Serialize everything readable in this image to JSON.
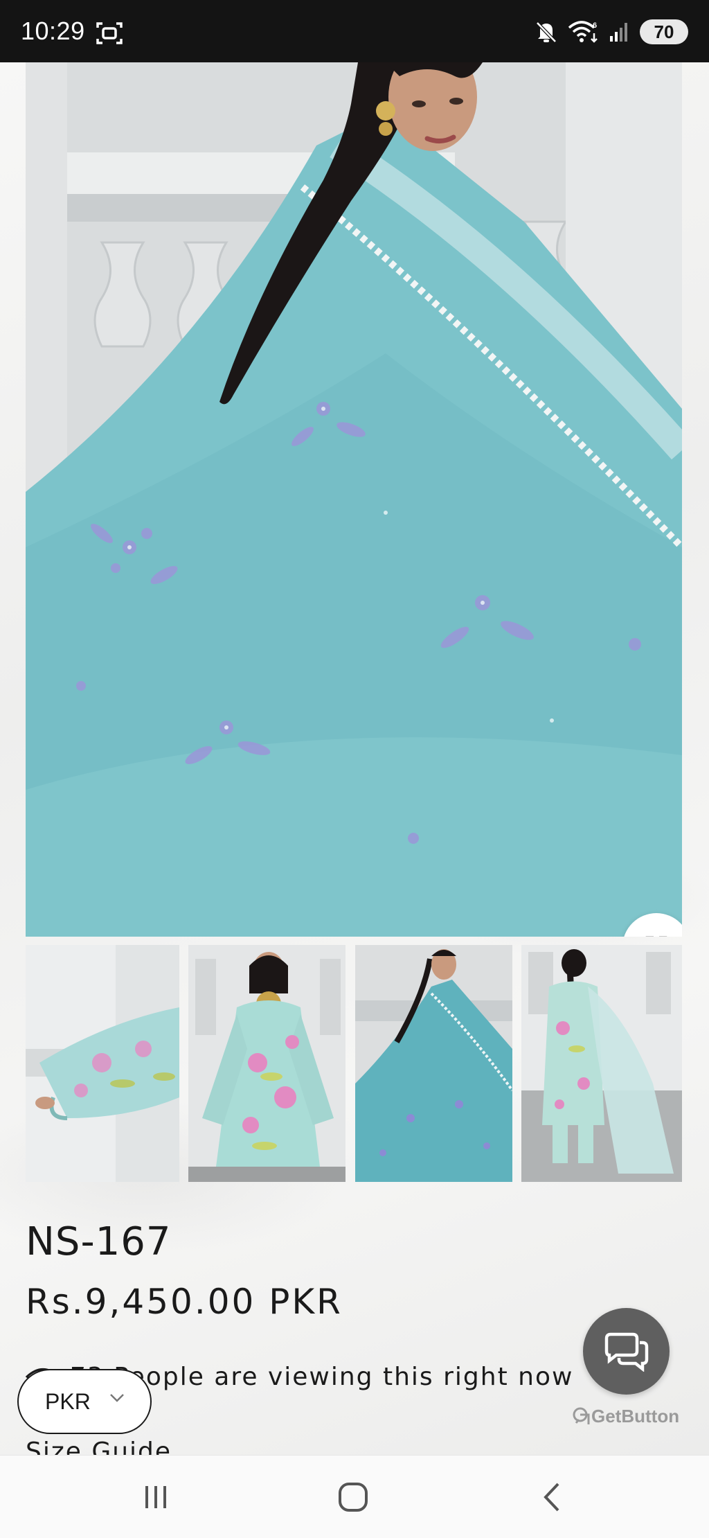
{
  "status_bar": {
    "time": "10:29",
    "battery": "70",
    "icons": [
      "screenshot-icon",
      "mute-icon",
      "wifi-icon",
      "signal-icon"
    ]
  },
  "gallery": {
    "expand_icon": "expand-icon",
    "thumbnails": [
      {
        "name": "thumbnail-sleeve-detail"
      },
      {
        "name": "thumbnail-front-view"
      },
      {
        "name": "thumbnail-dupatta-view"
      },
      {
        "name": "thumbnail-back-view"
      }
    ]
  },
  "product": {
    "title": "NS-167",
    "price": "Rs.9,450.00 PKR",
    "viewers_text": "73 People are viewing this right now",
    "size_guide": "Size Guide"
  },
  "currency_selector": {
    "value": "PKR"
  },
  "chat_widget": {
    "label": "GetButton"
  },
  "colors": {
    "fabric": "#7fc4cb",
    "embroidery": "#8f8fd4",
    "chat_button": "#5f5f5f",
    "status_bar": "#141414"
  }
}
